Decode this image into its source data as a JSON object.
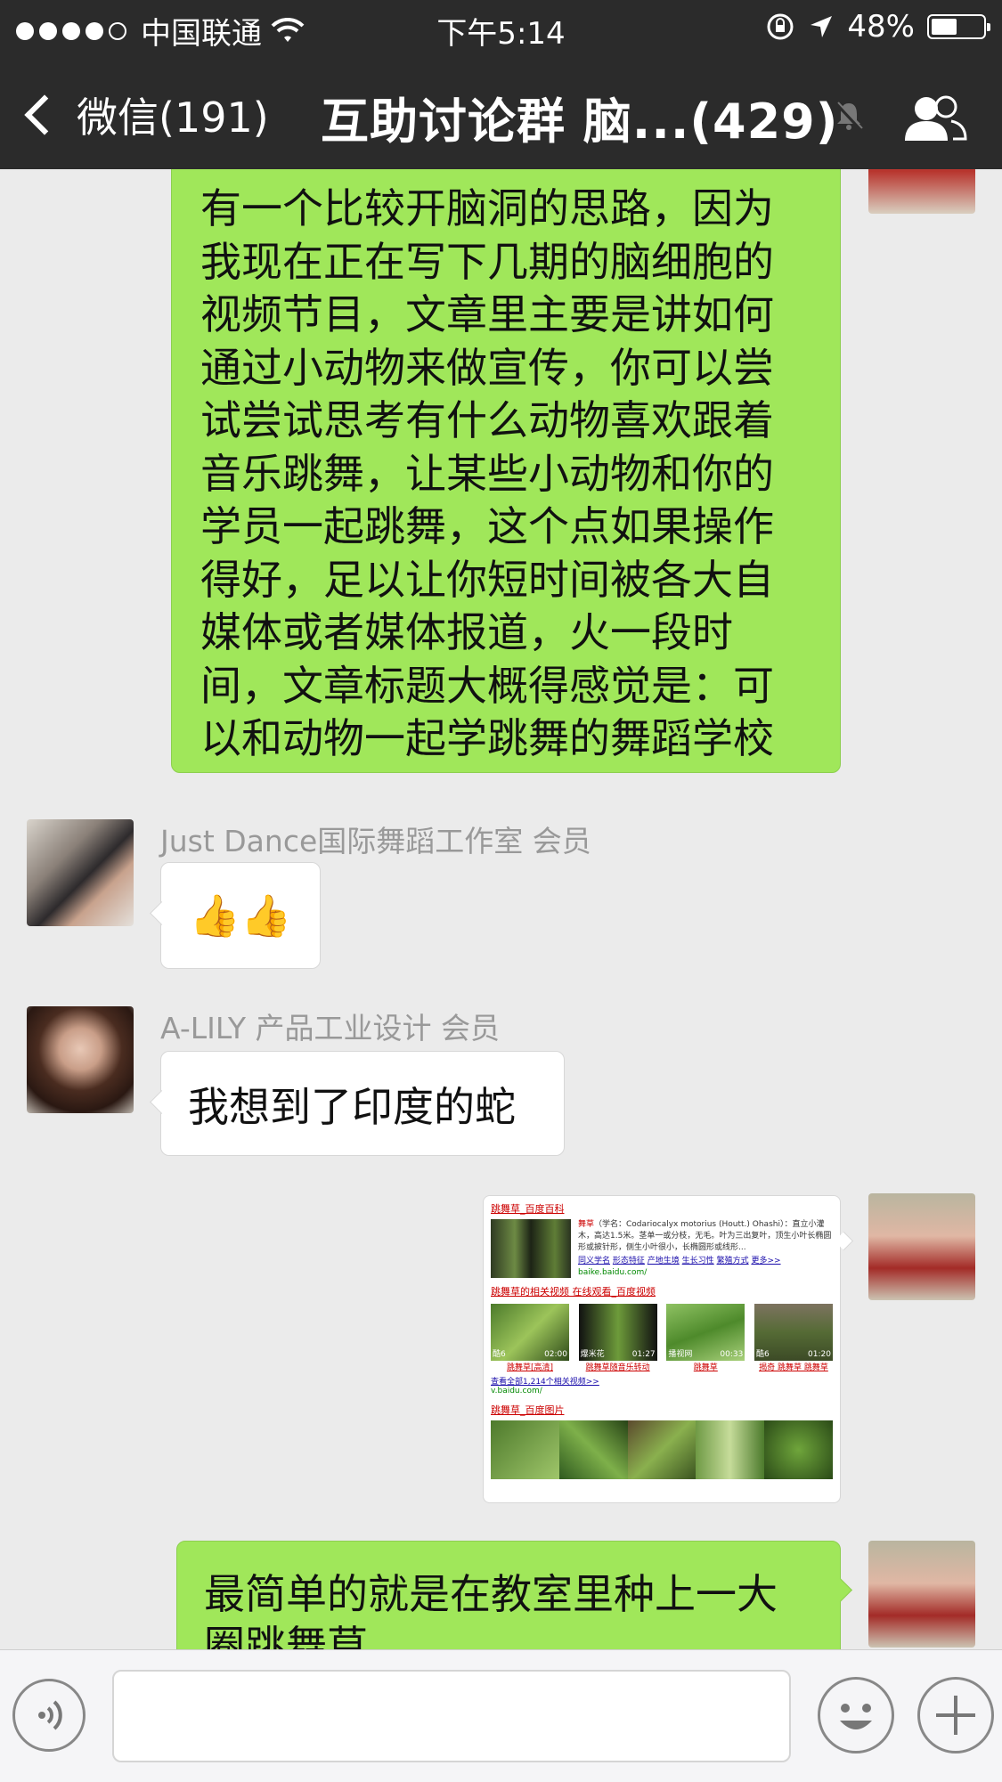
{
  "status_bar": {
    "carrier": "中国联通",
    "time": "下午5:14",
    "battery": "48%",
    "battery_level": 0.48
  },
  "nav": {
    "back_label": "微信(191)",
    "title": "互助讨论群 脑...(429)"
  },
  "messages": [
    {
      "type": "text",
      "side": "right",
      "text": "有一个比较开脑洞的思路，因为我现在正在写下几期的脑细胞的视频节目，文章里主要是讲如何通过小动物来做宣传，你可以尝试尝试思考有什么动物喜欢跟着音乐跳舞，让某些小动物和你的学员一起跳舞，这个点如果操作得好，足以让你短时间被各大自媒体或者媒体报道，火一段时间，文章标题大概得感觉是：可以和动物一起学跳舞的舞蹈学校"
    },
    {
      "type": "emoji",
      "side": "left",
      "sender": "Just Dance国际舞蹈工作室 会员",
      "text": "👍👍"
    },
    {
      "type": "text",
      "side": "left",
      "sender": "A-LILY 产品工业设计 会员",
      "text": "我想到了印度的蛇"
    },
    {
      "type": "image",
      "side": "right",
      "card": {
        "title1": "跳舞草_百度百科",
        "snippet_head": "舞草",
        "snippet": "（学名：Codariocalyx motorius (Houtt.) Ohashi）：直立小灌木，高达1.5米。茎单一或分枝，无毛。叶为三出复叶，顶生小叶长椭圆形或披针形，侧生小叶很小，长椭圆形或线形...",
        "links": [
          "同义学名",
          "形态特征",
          "产地生境",
          "生长习性",
          "繁殖方式",
          "更多>>"
        ],
        "url1": "baike.baidu.com/",
        "title2": "跳舞草的相关视频 在线观看_百度视频",
        "videos": [
          {
            "source": "酷6",
            "duration": "02:00",
            "caption": "跳舞草[高清]"
          },
          {
            "source": "爆米花",
            "duration": "01:27",
            "caption": "跳舞草随音乐转动"
          },
          {
            "source": "播视网",
            "duration": "00:33",
            "caption": "跳舞草"
          },
          {
            "source": "酷6",
            "duration": "01:20",
            "caption": "揭奇 跳舞草 跳舞草"
          }
        ],
        "more_videos": "查看全部1,214个相关视频>>",
        "url2": "v.baidu.com/",
        "title3": "跳舞草_百度图片"
      }
    },
    {
      "type": "text",
      "side": "right",
      "text": "最简单的就是在教室里种上一大圈跳舞草"
    }
  ],
  "input": {
    "value": "",
    "placeholder": ""
  },
  "colors": {
    "bar": "#2b2b2b",
    "chat_bg": "#ebebeb",
    "bubble_green": "#a0e75a",
    "bubble_white": "#ffffff"
  }
}
